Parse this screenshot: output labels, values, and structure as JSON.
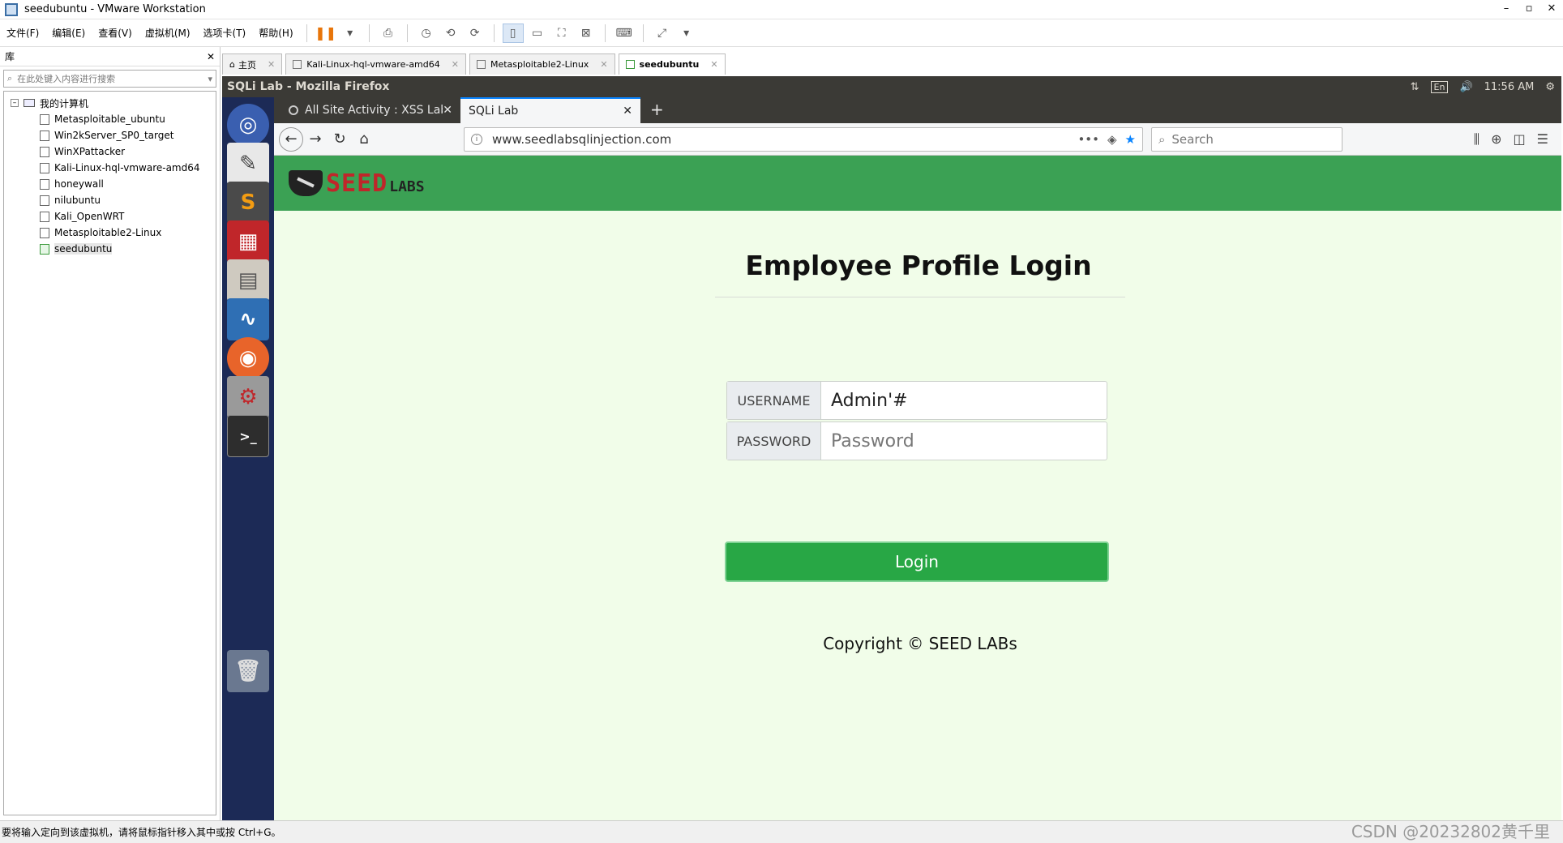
{
  "window": {
    "title": "seedubuntu - VMware Workstation"
  },
  "menubar": {
    "items": [
      "文件(F)",
      "编辑(E)",
      "查看(V)",
      "虚拟机(M)",
      "选项卡(T)",
      "帮助(H)"
    ]
  },
  "library": {
    "title": "库",
    "search_placeholder": "在此处键入内容进行搜索",
    "root_label": "我的计算机",
    "vms": [
      {
        "label": "Metasploitable_ubuntu",
        "running": false
      },
      {
        "label": "Win2kServer_SP0_target",
        "running": false
      },
      {
        "label": "WinXPattacker",
        "running": false
      },
      {
        "label": "Kali-Linux-hql-vmware-amd64",
        "running": false
      },
      {
        "label": "honeywall",
        "running": false
      },
      {
        "label": "nilubuntu",
        "running": false
      },
      {
        "label": "Kali_OpenWRT",
        "running": false
      },
      {
        "label": "Metasploitable2-Linux",
        "running": false
      },
      {
        "label": "seedubuntu",
        "running": true
      }
    ]
  },
  "vm_tabs": [
    {
      "label": "主页",
      "active": false
    },
    {
      "label": "Kali-Linux-hql-vmware-amd64",
      "active": false
    },
    {
      "label": "Metasploitable2-Linux",
      "active": false
    },
    {
      "label": "seedubuntu",
      "active": true
    }
  ],
  "ubuntu": {
    "window_title": "SQLi Lab - Mozilla Firefox",
    "keyboard": "En",
    "time": "11:56 AM"
  },
  "firefox": {
    "tabs": [
      {
        "label": "All Site Activity : XSS Lab",
        "active": false
      },
      {
        "label": "SQLi Lab",
        "active": true
      }
    ],
    "url": "www.seedlabsqlinjection.com",
    "search_placeholder": "Search"
  },
  "page": {
    "logo_seed": "SEED",
    "logo_labs": "LABS",
    "title": "Employee Profile Login",
    "username_label": "USERNAME",
    "username_value": "Admin'#",
    "password_label": "PASSWORD",
    "password_placeholder": "Password",
    "login_button": "Login",
    "copyright": "Copyright © SEED LABs"
  },
  "status_bar": {
    "text": "要将输入定向到该虚拟机，请将鼠标指针移入其中或按 Ctrl+G。"
  },
  "watermark": "CSDN @20232802黄千里",
  "colors": {
    "seed_green": "#3ba154",
    "login_green": "#28a745",
    "page_bg": "#f1fde9",
    "launcher_bg": "#1c2a56",
    "ubuntu_bar": "#3b3a36"
  }
}
